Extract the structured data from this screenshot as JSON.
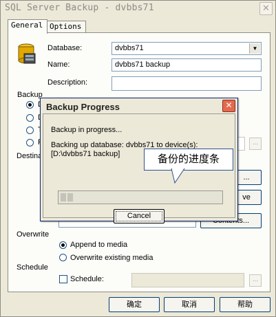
{
  "window": {
    "title": "SQL Server Backup - dvbbs71",
    "close_glyph": "✕"
  },
  "tabs": [
    {
      "label": "General"
    },
    {
      "label": "Options"
    }
  ],
  "general": {
    "database_label": "Database:",
    "database_value": "dvbbs71",
    "name_label": "Name:",
    "name_value": "dvbbs71 backup",
    "description_label": "Description:",
    "description_value": ""
  },
  "backup": {
    "group_label": "Backup",
    "options": [
      {
        "text": "D"
      },
      {
        "text": "D"
      },
      {
        "text": "T"
      },
      {
        "text": "F"
      }
    ]
  },
  "destination": {
    "label": "Destina",
    "add_label": "...",
    "remove_label": "ve",
    "contents_label": "Contents..."
  },
  "overwrite": {
    "label": "Overwrite",
    "append_label": "Append to media",
    "overwrite_label": "Overwrite existing media"
  },
  "schedule": {
    "group_label": "Schedule",
    "checkbox_label": "Schedule:",
    "field_value": "",
    "browse_label": "..."
  },
  "buttons": {
    "ok": "确定",
    "cancel": "取消",
    "help": "帮助"
  },
  "progress_dialog": {
    "title": "Backup Progress",
    "close_glyph": "✕",
    "status": "Backup in progress...",
    "detail_line1": "Backing up database: dvbbs71 to device(s):",
    "detail_line2": "[D:\\dvbbs71 backup]",
    "progress_fraction": 0.08,
    "cancel_label": "Cancel"
  },
  "annotation": {
    "text": "备份的进度条"
  }
}
